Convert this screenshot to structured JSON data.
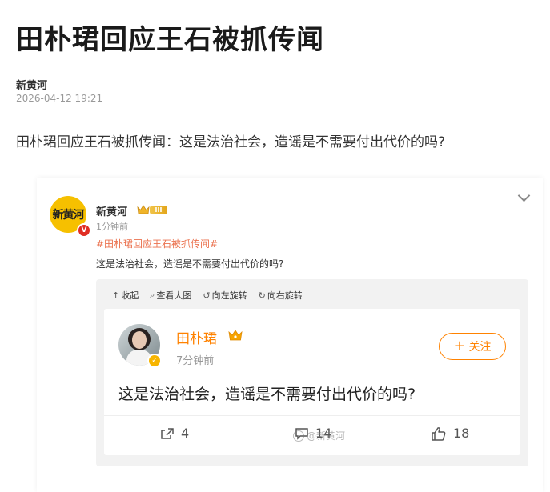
{
  "article": {
    "title": "田朴珺回应王石被抓传闻",
    "author": "新黄河",
    "date": "2026-04-12 19:21",
    "lead": "田朴珺回应王石被抓传闻：这是法治社会，造谣是不需要付出代价的吗?"
  },
  "post": {
    "avatar_text": "新黄河",
    "verified_badge": "V",
    "author": "新黄河",
    "level": "III",
    "time": "1分钟前",
    "topic": "#田朴珺回应王石被抓传闻#",
    "text": "这是法治社会，造谣是不需要付出代价的吗?",
    "icons": {
      "collapse": "chevron-down-icon",
      "crown": "crown-icon"
    }
  },
  "toolbar": {
    "collapse": "收起",
    "view_large": "查看大图",
    "rotate_left": "向左旋转",
    "rotate_right": "向右旋转"
  },
  "embedded": {
    "author": "田朴珺",
    "time": "7分钟前",
    "follow_label": "关注",
    "text": "这是法治社会，造谣是不需要付出代价的吗?",
    "reposts": "4",
    "comments": "14",
    "likes": "18",
    "watermark": "@新黄河"
  },
  "colors": {
    "accent": "#ff8200",
    "topic": "#eb7350",
    "verified": "#e02e24"
  }
}
